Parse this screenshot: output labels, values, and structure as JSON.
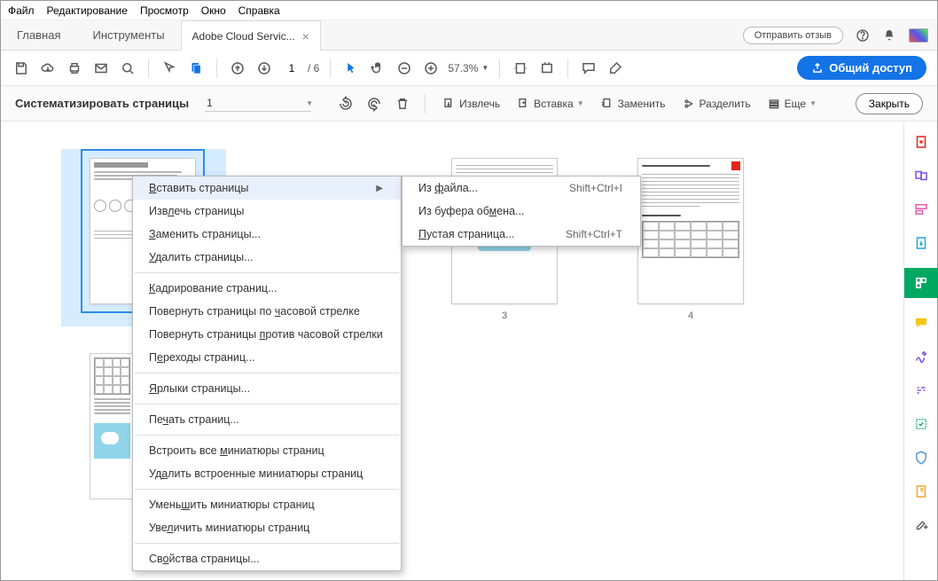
{
  "menubar": [
    "Файл",
    "Редактирование",
    "Просмотр",
    "Окно",
    "Справка"
  ],
  "tabs": {
    "home": "Главная",
    "tools": "Инструменты",
    "doc": "Adobe Cloud Servic..."
  },
  "feedback": "Отправить отзыв",
  "toolbar": {
    "page_current": "1",
    "page_total": "/ 6",
    "zoom": "57.3%",
    "share": "Общий доступ"
  },
  "organize": {
    "title": "Систематизировать страницы",
    "sel": "1",
    "extract": "Извлечь",
    "insert": "Вставка",
    "replace": "Заменить",
    "split": "Разделить",
    "more": "Еще",
    "close": "Закрыть"
  },
  "pages": {
    "p3": "3",
    "p4": "4"
  },
  "ctx_main": [
    "Вставить страницы",
    "Извлечь страницы",
    "Заменить страницы...",
    "Удалить страницы...",
    "Кадрирование страниц...",
    "Повернуть страницы по часовой стрелке",
    "Повернуть страницы против часовой стрелки",
    "Переходы страниц...",
    "Ярлыки страницы...",
    "Печать страниц...",
    "Встроить все миниатюры страниц",
    "Удалить встроенные миниатюры страниц",
    "Уменьшить миниатюры страниц",
    "Увеличить миниатюры страниц",
    "Свойства страницы..."
  ],
  "submenu": {
    "file": "Из файла...",
    "file_sc": "Shift+Ctrl+I",
    "clip": "Из буфера обмена...",
    "blank": "Пустая страница...",
    "blank_sc": "Shift+Ctrl+T"
  }
}
